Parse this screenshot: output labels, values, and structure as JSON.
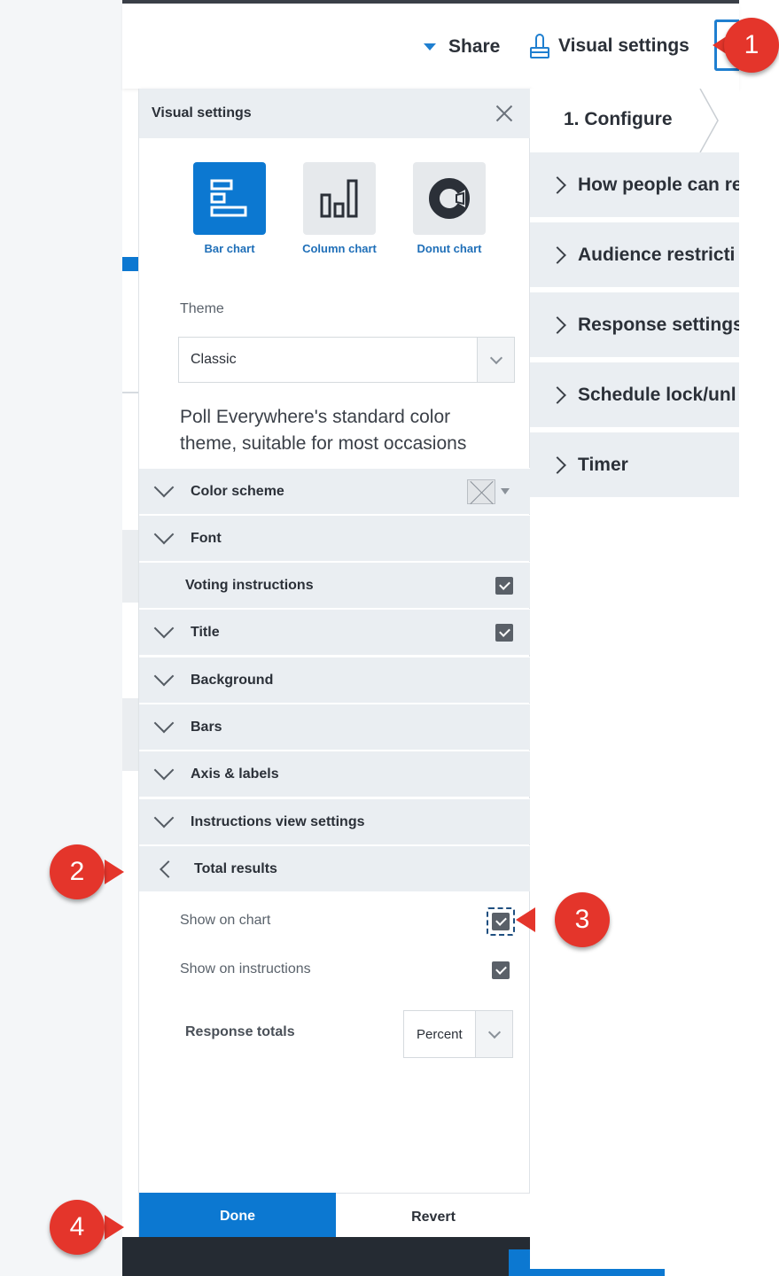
{
  "header": {
    "share_label": "Share",
    "visual_settings_label": "Visual settings"
  },
  "panel": {
    "title": "Visual settings",
    "chart_types": [
      {
        "label": "Bar chart",
        "icon": "bar-chart-icon",
        "selected": true
      },
      {
        "label": "Column chart",
        "icon": "column-chart-icon",
        "selected": false
      },
      {
        "label": "Donut chart",
        "icon": "donut-chart-icon",
        "selected": false
      }
    ],
    "theme_label": "Theme",
    "theme_value": "Classic",
    "theme_description": "Poll Everywhere's standard color theme, suitable for most occasions",
    "sections": {
      "color_scheme": "Color scheme",
      "font": "Font",
      "voting_instructions": "Voting instructions",
      "title": "Title",
      "background": "Background",
      "bars": "Bars",
      "axis_labels": "Axis & labels",
      "instructions_view": "Instructions view settings",
      "total_results": "Total results"
    },
    "total_results": {
      "show_on_chart": "Show on chart",
      "show_on_instructions": "Show on instructions",
      "response_totals_label": "Response totals",
      "response_totals_value": "Percent"
    },
    "done_label": "Done",
    "revert_label": "Revert"
  },
  "right_nav": {
    "step": "1. Configure",
    "items": [
      "How people can re",
      "Audience restricti",
      "Response settings",
      "Schedule lock/unl",
      "Timer"
    ]
  },
  "callouts": [
    "1",
    "2",
    "3",
    "4"
  ],
  "colors": {
    "accent": "#0c78d1",
    "callout": "#e4352b",
    "row_bg": "#eaeef2"
  }
}
